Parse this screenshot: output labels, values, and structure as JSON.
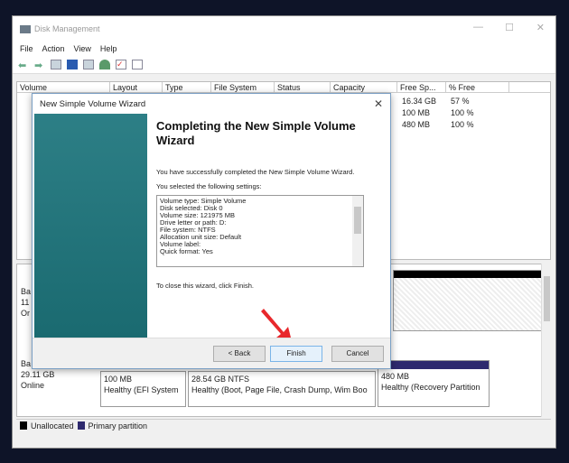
{
  "window": {
    "title": "Disk Management",
    "minimize": "—",
    "maximize": "☐",
    "close": "✕"
  },
  "menu": [
    "File",
    "Action",
    "View",
    "Help"
  ],
  "columns": [
    "Volume",
    "Layout",
    "Type",
    "File System",
    "Status",
    "Capacity",
    "Free Sp...",
    "% Free"
  ],
  "rows": [
    {
      "free": "16.34 GB",
      "pct": "57 %"
    },
    {
      "free": "100 MB",
      "pct": "100 %"
    },
    {
      "free": "480 MB",
      "pct": "100 %"
    }
  ],
  "disks": [
    {
      "label": "Ba",
      "size": "11",
      "status": "Or"
    },
    {
      "label": "Ba",
      "size": "29.11 GB",
      "status": "Online"
    }
  ],
  "partitions": [
    {
      "size": "100 MB",
      "status": "Healthy (EFI System"
    },
    {
      "size": "28.54 GB NTFS",
      "status": "Healthy (Boot, Page File, Crash Dump, Wim Boo"
    },
    {
      "size": "480 MB",
      "status": "Healthy (Recovery Partition"
    }
  ],
  "legend": {
    "unallocated": "Unallocated",
    "primary": "Primary partition",
    "colors": {
      "unallocated": "#000000",
      "primary": "#2e2a6e"
    }
  },
  "dialog": {
    "title": "New Simple Volume Wizard",
    "close": "✕",
    "heading": "Completing the New Simple Volume Wizard",
    "success": "You have successfully completed the New Simple Volume Wizard.",
    "selected": "You selected the following settings:",
    "settings": [
      "Volume type: Simple Volume",
      "Disk selected: Disk 0",
      "Volume size: 121975 MB",
      "Drive letter or path: D:",
      "File system: NTFS",
      "Allocation unit size: Default",
      "Volume label:",
      "Quick format: Yes"
    ],
    "close_hint": "To close this wizard, click Finish.",
    "back": "< Back",
    "finish": "Finish",
    "cancel": "Cancel"
  }
}
